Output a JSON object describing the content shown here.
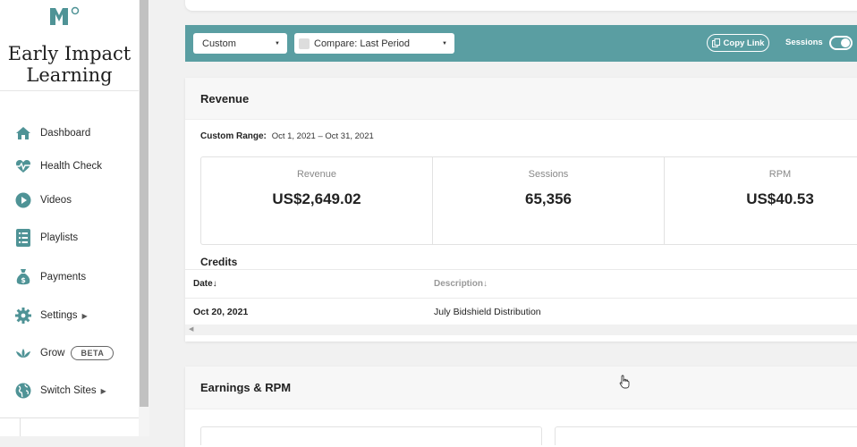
{
  "sidebar": {
    "site_title_line1": "Early Impact",
    "site_title_line2": "Learning",
    "items": [
      {
        "label": "Dashboard",
        "icon": "home-icon"
      },
      {
        "label": "Health Check",
        "icon": "heartbeat-icon"
      },
      {
        "label": "Videos",
        "icon": "play-circle-icon"
      },
      {
        "label": "Playlists",
        "icon": "list-icon"
      },
      {
        "label": "Payments",
        "icon": "money-bag-icon"
      },
      {
        "label": "Settings",
        "icon": "gear-icon"
      },
      {
        "label": "Grow",
        "icon": "lotus-icon",
        "badge": "BETA"
      },
      {
        "label": "Switch Sites",
        "icon": "globe-icon"
      }
    ]
  },
  "toolbar": {
    "range_select": "Custom",
    "compare_select": "Compare: Last Period",
    "copy_link": "Copy Link",
    "sessions_label": "Sessions"
  },
  "revenue": {
    "title": "Revenue",
    "range_label": "Custom Range:",
    "range_value": "Oct 1, 2021 – Oct 31, 2021",
    "metrics": [
      {
        "label": "Revenue",
        "value": "US$2,649.02"
      },
      {
        "label": "Sessions",
        "value": "65,356"
      },
      {
        "label": "RPM",
        "value": "US$40.53"
      }
    ],
    "credits_title": "Credits",
    "columns": [
      "Date↓",
      "Description↓"
    ],
    "rows": [
      {
        "date": "Oct 20, 2021",
        "description": "July Bidshield Distribution"
      }
    ]
  },
  "earnings": {
    "title": "Earnings & RPM"
  },
  "colors": {
    "accent": "#5a9ea2",
    "icon": "#4f9396"
  }
}
